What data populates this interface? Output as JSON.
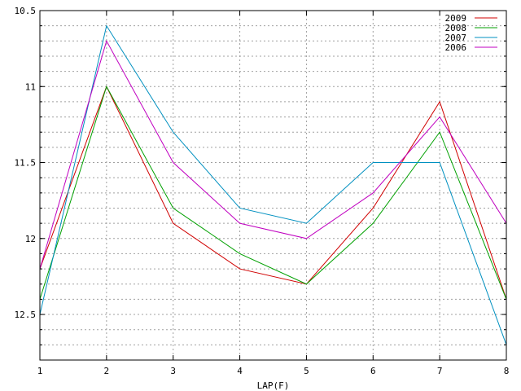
{
  "chart_data": {
    "type": "line",
    "title": "",
    "xlabel": "LAP(F)",
    "ylabel": "",
    "x": [
      1,
      2,
      3,
      4,
      5,
      6,
      7,
      8
    ],
    "xlim": [
      1,
      8
    ],
    "ylim": [
      12.8,
      10.5
    ],
    "y_inverted": true,
    "y_ticks": [
      10.5,
      11,
      11.5,
      12,
      12.5
    ],
    "y_tick_labels": [
      "10.5",
      "11",
      "11.5",
      "12",
      "12.5"
    ],
    "y_minor_step": 0.1,
    "grid": true,
    "legend": "top-right",
    "series": [
      {
        "name": "2009",
        "color": "#d00000",
        "values": [
          12.2,
          11.0,
          11.9,
          12.2,
          12.3,
          11.8,
          11.1,
          12.4
        ]
      },
      {
        "name": "2008",
        "color": "#00a000",
        "values": [
          12.4,
          11.0,
          11.8,
          12.1,
          12.3,
          11.9,
          11.3,
          12.4
        ]
      },
      {
        "name": "2007",
        "color": "#0090c0",
        "values": [
          12.5,
          10.6,
          11.3,
          11.8,
          11.9,
          11.5,
          11.5,
          12.7
        ]
      },
      {
        "name": "2006",
        "color": "#c000c0",
        "values": [
          12.2,
          10.7,
          11.5,
          11.9,
          12.0,
          11.7,
          11.2,
          11.9
        ]
      }
    ]
  }
}
